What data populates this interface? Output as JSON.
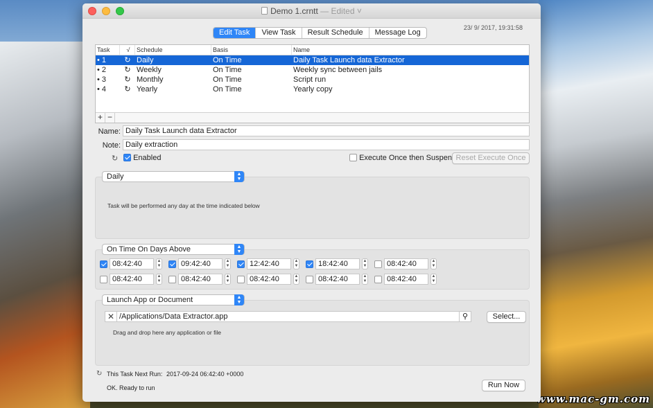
{
  "window": {
    "title": "Demo 1.crntt",
    "edited": "— Edited ˅",
    "timestamp": "23/ 9/ 2017, 19:31:58"
  },
  "tabs": [
    "Edit Task",
    "View Task",
    "Result Schedule",
    "Message Log"
  ],
  "table": {
    "headers": [
      "Task",
      "√",
      "Schedule",
      "Basis",
      "Name"
    ],
    "rows": [
      {
        "task": "• 1",
        "schedule": "Daily",
        "basis": "On Time",
        "name": "Daily Task Launch data Extractor"
      },
      {
        "task": "• 2",
        "schedule": "Weekly",
        "basis": "On Time",
        "name": "Weekly sync between jails"
      },
      {
        "task": "• 3",
        "schedule": "Monthly",
        "basis": "On Time",
        "name": "Script run"
      },
      {
        "task": "• 4",
        "schedule": "Yearly",
        "basis": "On Time",
        "name": "Yearly copy"
      }
    ],
    "add_label": "+",
    "remove_label": "−"
  },
  "form": {
    "name_label": "Name:",
    "name_value": "Daily Task Launch data Extractor",
    "note_label": "Note:",
    "note_value": "Daily extraction",
    "enabled_label": "Enabled",
    "execute_once_label": "Execute Once then Suspend",
    "reset_label": "Reset Execute Once"
  },
  "schedule": {
    "selected": "Daily",
    "description": "Task will be performed any day at the time indicated below"
  },
  "basis": {
    "selected": "On Time On Days Above",
    "times_row1": [
      {
        "value": "08:42:40",
        "checked": true
      },
      {
        "value": "09:42:40",
        "checked": true
      },
      {
        "value": "12:42:40",
        "checked": true
      },
      {
        "value": "18:42:40",
        "checked": true
      },
      {
        "value": "08:42:40",
        "checked": false
      }
    ],
    "times_row2": [
      {
        "value": "08:42:40",
        "checked": false
      },
      {
        "value": "08:42:40",
        "checked": false
      },
      {
        "value": "08:42:40",
        "checked": false
      },
      {
        "value": "08:42:40",
        "checked": false
      },
      {
        "value": "08:42:40",
        "checked": false
      }
    ]
  },
  "action": {
    "selected": "Launch App or Document",
    "path": "/Applications/Data Extractor.app",
    "select_label": "Select...",
    "hint": "Drag and drop here any application or file"
  },
  "status": {
    "next_run_label": "This Task Next Run:",
    "next_run_value": "2017-09-24 06:42:40 +0000",
    "message": "OK. Ready to run",
    "run_now_label": "Run Now"
  },
  "watermark": "www.mac-gm.com"
}
